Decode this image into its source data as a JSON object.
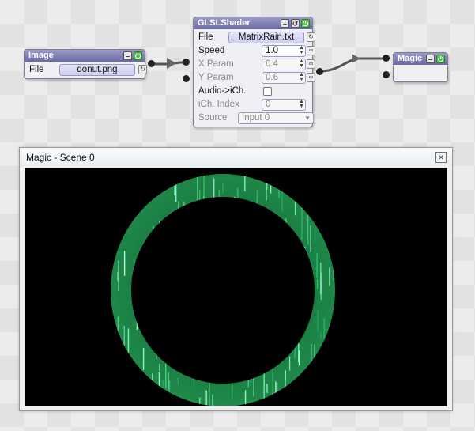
{
  "image_node": {
    "title": "Image",
    "file_label": "File",
    "file_value": "donut.png",
    "file_button_icon": "cycle-icon"
  },
  "shader_node": {
    "title": "GLSLShader",
    "file_label": "File",
    "file_value": "MatrixRain.txt",
    "speed_label": "Speed",
    "speed_value": "1.0",
    "xparam_label": "X Param",
    "xparam_value": "0.4",
    "yparam_label": "Y Param",
    "yparam_value": "0.6",
    "audio_label": "Audio->iCh.",
    "audio_checked": false,
    "ich_label": "iCh. Index",
    "ich_value": "0",
    "source_label": "Source",
    "source_value": "Input 0"
  },
  "magic_node": {
    "title": "Magic"
  },
  "output_window": {
    "title": "Magic - Scene 0",
    "close_icon": "close-icon"
  },
  "colors": {
    "node_header": "#7a7ab0",
    "ring_green": "#1f8a4a",
    "rain_bright": "#b8ffd8",
    "background": "#000000"
  }
}
